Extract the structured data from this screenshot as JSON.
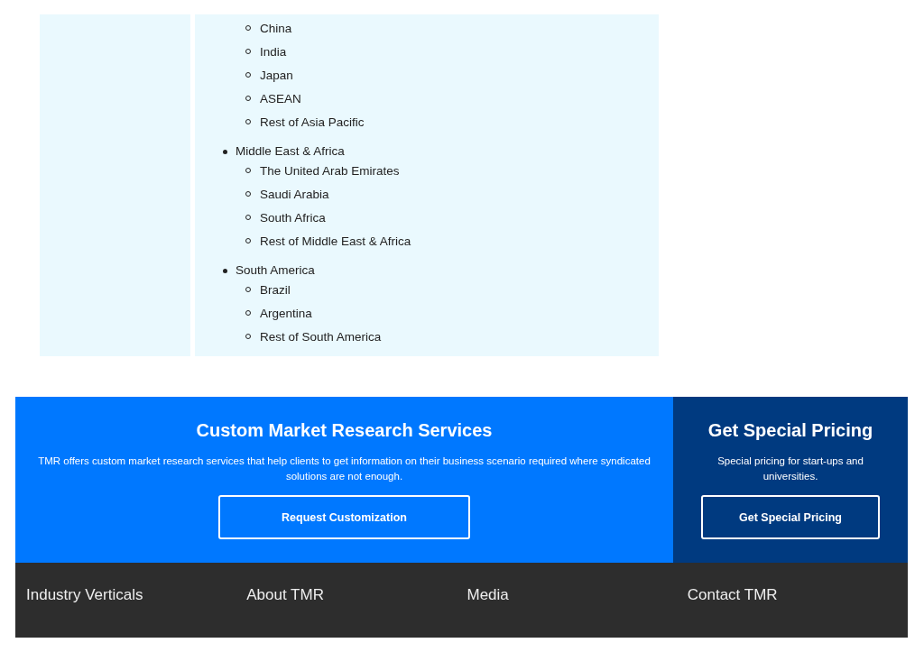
{
  "regions": [
    {
      "children": [
        "China",
        "India",
        "Japan",
        "ASEAN",
        "Rest of Asia Pacific"
      ]
    },
    {
      "name": "Middle East & Africa",
      "children": [
        "The United Arab Emirates",
        "Saudi Arabia",
        "South Africa",
        "Rest of Middle East & Africa"
      ]
    },
    {
      "name": "South America",
      "children": [
        "Brazil",
        "Argentina",
        "Rest of South America"
      ]
    }
  ],
  "custom_research": {
    "title": "Custom Market Research Services",
    "text": "TMR offers custom market research services that help clients to get information on their business scenario required where syndicated solutions are not enough.",
    "button": "Request Customization"
  },
  "special_pricing": {
    "title": "Get Special Pricing",
    "text": "Special pricing for start-ups and universities.",
    "button": "Get Special Pricing"
  },
  "footer_links": [
    "Industry Verticals",
    "About TMR",
    "Media",
    "Contact TMR"
  ]
}
